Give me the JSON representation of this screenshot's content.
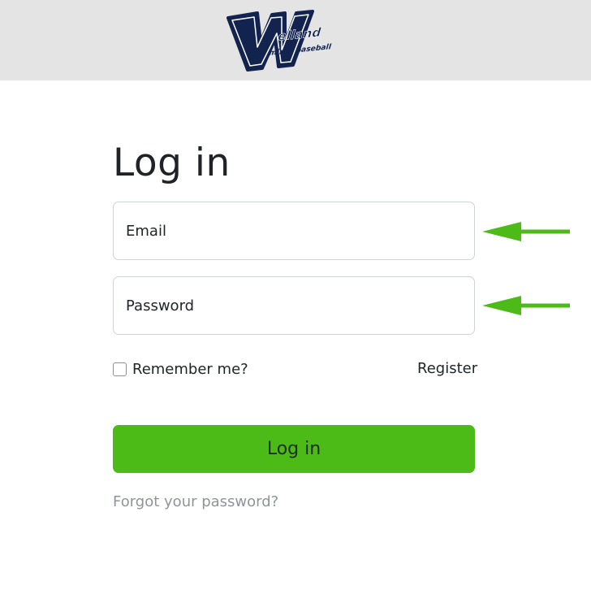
{
  "header": {
    "logo": {
      "name": "welland-logo",
      "text_main": "Welland",
      "text_sub": "minor baseball",
      "colors": {
        "primary": "#12234f",
        "outline": "#ffffff"
      }
    },
    "background_color": "#e4e4e4"
  },
  "main": {
    "title": "Log in",
    "fields": {
      "email": {
        "label": "Email",
        "value": ""
      },
      "password": {
        "label": "Password",
        "value": ""
      }
    },
    "remember_label": "Remember me?",
    "remember_checked": false,
    "register_label": "Register",
    "login_button_label": "Log in",
    "forgot_password_label": "Forgot your password?"
  },
  "annotations": {
    "arrow_color": "#4cbb17",
    "arrows": [
      "email-arrow",
      "password-arrow"
    ]
  },
  "colors": {
    "accent": "#4cbb17",
    "text": "#212529",
    "muted": "#8f949a"
  }
}
